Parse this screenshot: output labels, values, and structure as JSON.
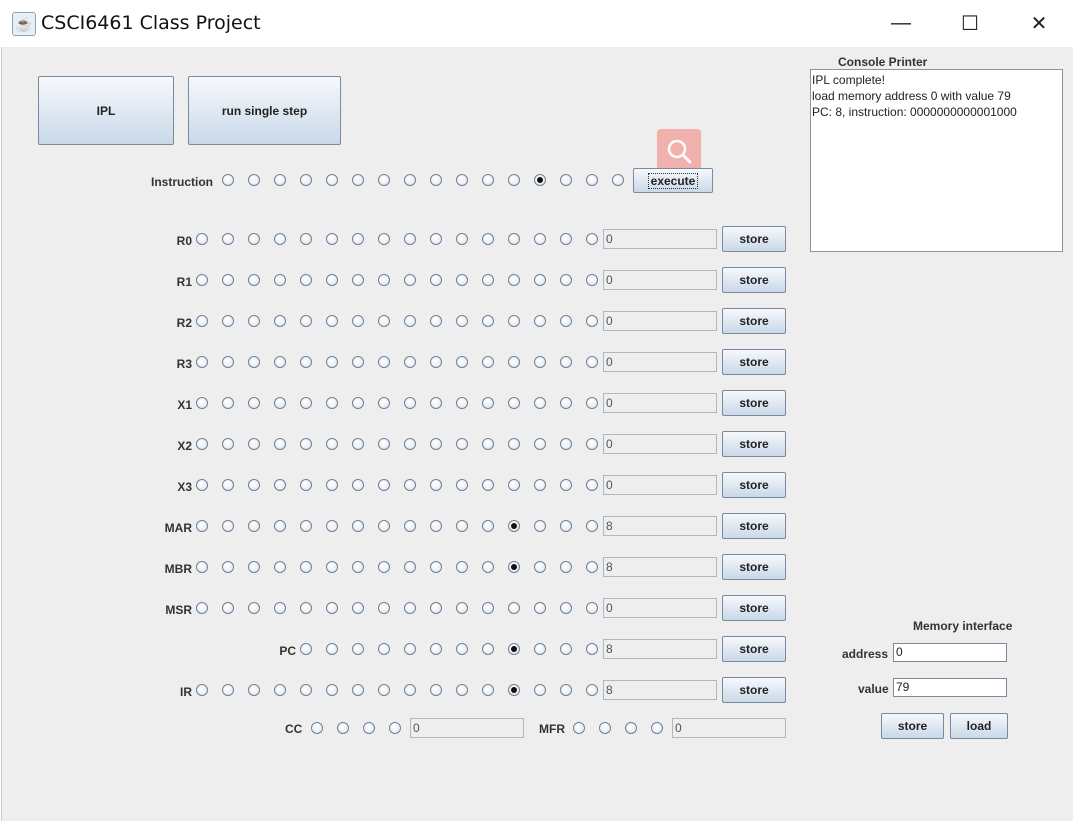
{
  "window": {
    "title": "CSCI6461 Class Project",
    "minimize_glyph": "—",
    "maximize_glyph": "☐",
    "close_glyph": "✕",
    "app_icon": "java-cup-icon"
  },
  "controls": {
    "ipl_label": "IPL",
    "single_step_label": "run single step",
    "execute_label": "execute"
  },
  "instruction": {
    "label": "Instruction",
    "bits": [
      0,
      0,
      0,
      0,
      0,
      0,
      0,
      0,
      0,
      0,
      0,
      0,
      1,
      0,
      0,
      0
    ]
  },
  "registers": [
    {
      "label": "R0",
      "bits": 16,
      "on": [],
      "value": "0",
      "store": "store"
    },
    {
      "label": "R1",
      "bits": 16,
      "on": [],
      "value": "0",
      "store": "store"
    },
    {
      "label": "R2",
      "bits": 16,
      "on": [],
      "value": "0",
      "store": "store"
    },
    {
      "label": "R3",
      "bits": 16,
      "on": [],
      "value": "0",
      "store": "store"
    },
    {
      "label": "X1",
      "bits": 16,
      "on": [],
      "value": "0",
      "store": "store"
    },
    {
      "label": "X2",
      "bits": 16,
      "on": [],
      "value": "0",
      "store": "store"
    },
    {
      "label": "X3",
      "bits": 16,
      "on": [],
      "value": "0",
      "store": "store"
    },
    {
      "label": "MAR",
      "bits": 16,
      "on": [
        12
      ],
      "value": "8",
      "store": "store"
    },
    {
      "label": "MBR",
      "bits": 16,
      "on": [
        12
      ],
      "value": "8",
      "store": "store"
    },
    {
      "label": "MSR",
      "bits": 16,
      "on": [],
      "value": "0",
      "store": "store"
    },
    {
      "label": "PC",
      "bits": 12,
      "on": [
        8
      ],
      "value": "8",
      "store": "store"
    },
    {
      "label": "IR",
      "bits": 16,
      "on": [
        12
      ],
      "value": "8",
      "store": "store"
    }
  ],
  "cc": {
    "label": "CC",
    "bits": [
      0,
      0,
      0,
      0
    ],
    "value": "0"
  },
  "mfr": {
    "label": "MFR",
    "bits": [
      0,
      0,
      0,
      0
    ],
    "value": "0"
  },
  "console": {
    "title": "Console Printer",
    "lines": [
      "IPL complete!",
      "load memory address 0 with value 79",
      "PC: 8, instruction: 0000000000001000"
    ]
  },
  "memory": {
    "title": "Memory interface",
    "address_label": "address",
    "address_value": "0",
    "value_label": "value",
    "value_value": "79",
    "store_label": "store",
    "load_label": "load"
  }
}
